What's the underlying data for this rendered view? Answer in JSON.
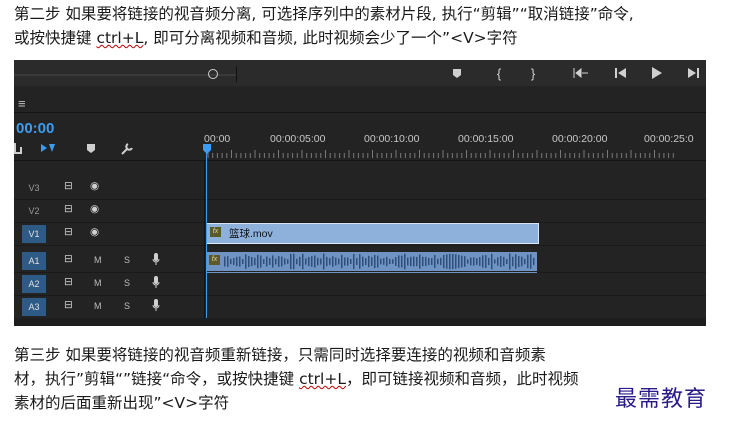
{
  "article": {
    "para1_line1": "第二步  如果要将链接的视音频分离, 可选择序列中的素材片段, 执行“剪辑”“取消链接”命令,",
    "para1_line2_pre": "或按快捷键 ",
    "para1_line2_kbd": "ctrl+L",
    "para1_line2_post": ",  即可分离视频和音频,  此时视频会少了一个”<V>字符",
    "para2_line1": "第三步 如果要将链接的视音频重新链接，只需同时选择要连接的视频和音频素",
    "para2_line2_pre": "材，执行”剪辑“”链接“命令，或按快捷键 ",
    "para2_line2_kbd": "ctrl+L",
    "para2_line2_post": "，即可链接视频和音频，此时视频",
    "para2_line3": "素材的后面重新出现”<V>字符",
    "watermark": "最需教育"
  },
  "timeline": {
    "timecode": "00:00",
    "menu_icon": "≡",
    "ruler": [
      "00:00",
      "00:00:05:00",
      "00:00:10:00",
      "00:00:15:00",
      "00:00:20:00",
      "00:00:25:0"
    ],
    "tracks": [
      {
        "label": "V3",
        "active": false
      },
      {
        "label": "V2",
        "active": false
      },
      {
        "label": "V1",
        "active": true
      },
      {
        "label": "A1",
        "active": true
      },
      {
        "label": "A2",
        "active": true
      },
      {
        "label": "A3",
        "active": true
      }
    ],
    "audio_m": "M",
    "audio_s": "S",
    "video_clip_name": "篮球.mov",
    "fx_label": "fx",
    "accent": "#3c9cf0",
    "clip_video_color": "#8eb1dc",
    "clip_audio_color": "#6f93c2"
  }
}
